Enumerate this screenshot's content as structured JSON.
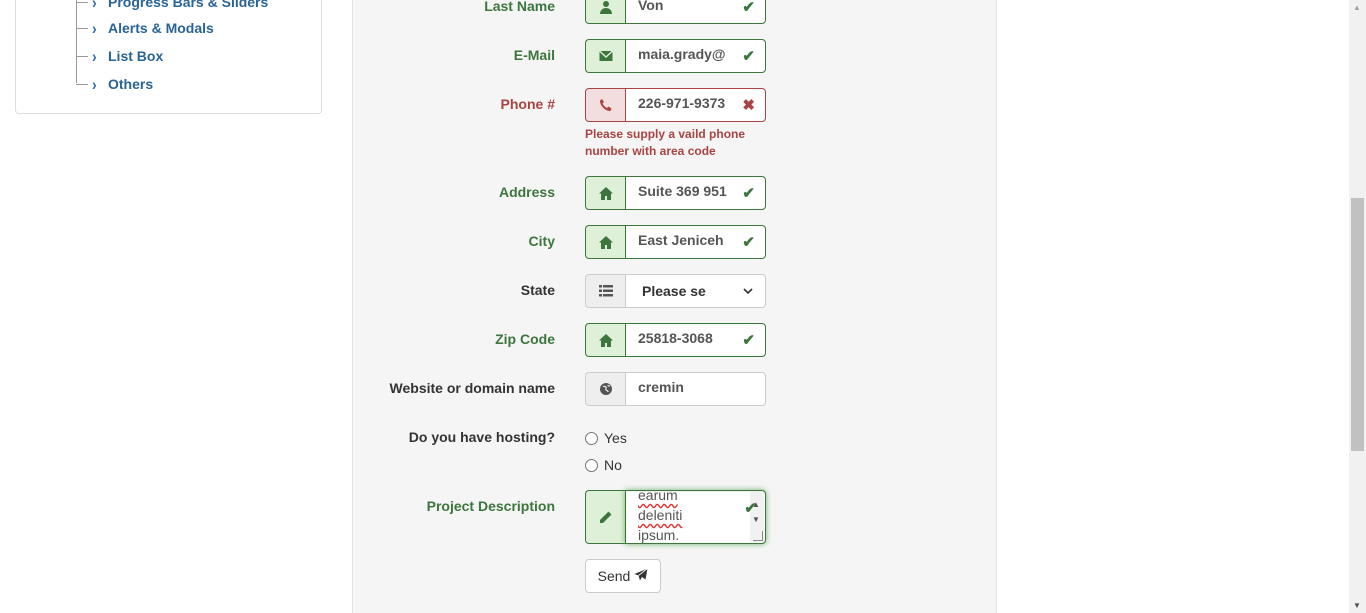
{
  "sidebar": {
    "items": [
      {
        "label": "Progress Bars & Sliders",
        "icon": "chevron-right-icon"
      },
      {
        "label": "Alerts & Modals",
        "icon": "chevron-right-icon"
      },
      {
        "label": "List Box",
        "icon": "chevron-right-icon"
      },
      {
        "label": "Others",
        "icon": "chevron-right-icon"
      }
    ]
  },
  "form": {
    "last_name": {
      "label": "Last Name",
      "value": "Von",
      "icon": "user-icon",
      "status": "valid"
    },
    "email": {
      "label": "E-Mail",
      "value": "maia.grady@",
      "icon": "envelope-icon",
      "status": "valid"
    },
    "phone": {
      "label": "Phone #",
      "value": "226-971-9373",
      "icon": "phone-icon",
      "status": "error",
      "help": "Please supply a vaild phone number with area code"
    },
    "address": {
      "label": "Address",
      "value": "Suite 369 951",
      "icon": "home-icon",
      "status": "valid"
    },
    "city": {
      "label": "City",
      "value": "East Jeniceh",
      "icon": "home-icon",
      "status": "valid"
    },
    "state": {
      "label": "State",
      "value": "Please se",
      "icon": "list-icon"
    },
    "zip": {
      "label": "Zip Code",
      "value": "25818-3068",
      "icon": "home-icon",
      "status": "valid"
    },
    "website": {
      "label": "Website or domain name",
      "value": "cremin",
      "icon": "globe-icon"
    },
    "hosting": {
      "label": "Do you have hosting?",
      "options": [
        "Yes",
        "No"
      ]
    },
    "description": {
      "label": "Project Description",
      "lines": [
        "earum",
        "deleniti",
        "ipsum."
      ],
      "icon": "pencil-icon",
      "status": "valid"
    },
    "send_label": "Send"
  },
  "colors": {
    "valid": "#3c763d",
    "error": "#a94442",
    "link": "#2a6496"
  }
}
